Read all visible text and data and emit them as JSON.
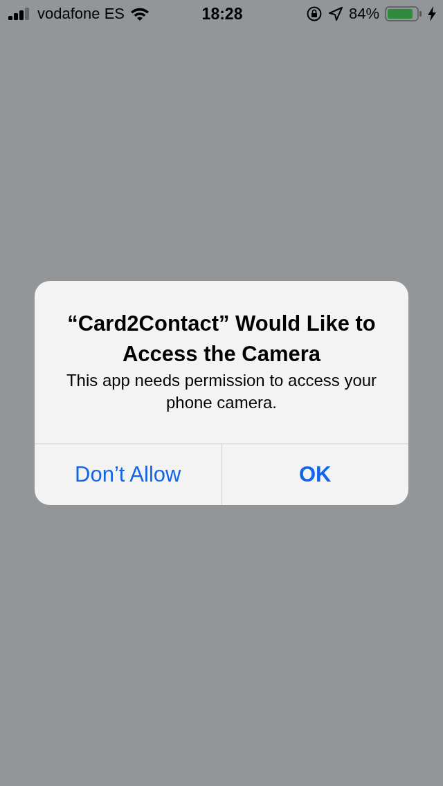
{
  "status_bar": {
    "carrier": "vodafone ES",
    "time": "18:28",
    "battery": "84%"
  },
  "alert": {
    "title": "“Card2Contact” Would Like to Access the Camera",
    "message": "This app needs permission to access your phone camera.",
    "buttons": [
      {
        "label": "Don’t Allow",
        "kind": "cancel"
      },
      {
        "label": "OK",
        "kind": "default"
      }
    ]
  }
}
